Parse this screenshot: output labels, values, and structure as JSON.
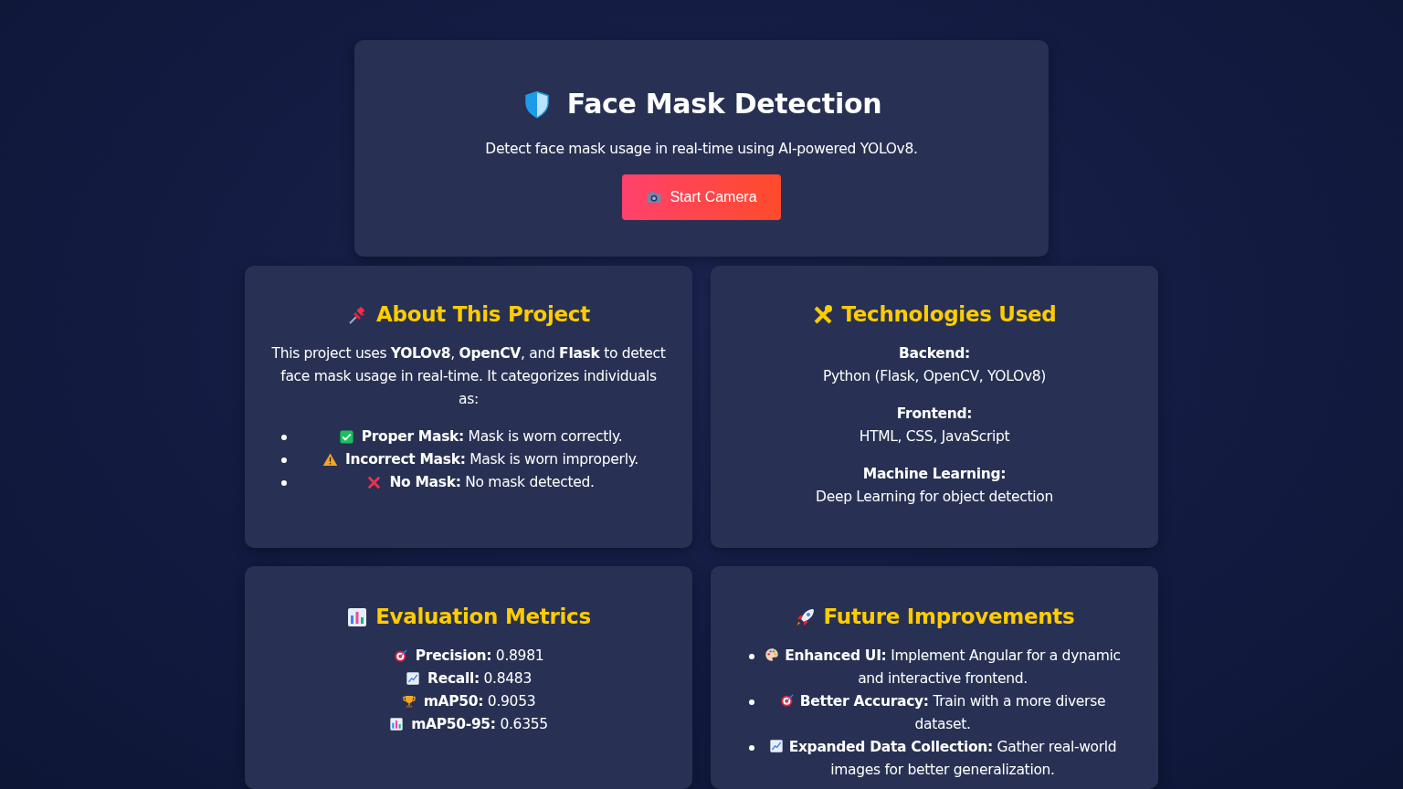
{
  "header": {
    "kind": "shield",
    "title": "Face Mask Detection",
    "subtitle": "Detect face mask usage in real-time using AI-powered YOLOv8.",
    "button": {
      "kind": "camera",
      "label": "Start Camera"
    }
  },
  "about": {
    "kind": "pin",
    "title": "About This Project",
    "intro": "This project uses **YOLOv8**, **OpenCV**, and **Flask** to detect face mask usage in real-time. It categorizes individuals as:",
    "items": [
      {
        "kind": "check",
        "label": "Proper Mask:",
        "text": "Mask is worn correctly."
      },
      {
        "kind": "warning",
        "label": "Incorrect Mask:",
        "text": "Mask is worn improperly."
      },
      {
        "kind": "cross",
        "label": "No Mask:",
        "text": "No mask detected."
      }
    ]
  },
  "technologies": {
    "kind": "tools",
    "title": "Technologies Used",
    "groups": [
      {
        "label": "Backend:",
        "value": "Python (Flask, OpenCV, YOLOv8)"
      },
      {
        "label": "Frontend:",
        "value": "HTML, CSS, JavaScript"
      },
      {
        "label": "Machine Learning:",
        "value": "Deep Learning for object detection"
      }
    ]
  },
  "metrics": {
    "kind": "barchart",
    "title": "Evaluation Metrics",
    "items": [
      {
        "kind": "target",
        "label": "Precision:",
        "value": "0.8981"
      },
      {
        "kind": "trend",
        "label": "Recall:",
        "value": "0.8483"
      },
      {
        "kind": "trophy",
        "label": "mAP50:",
        "value": "0.9053"
      },
      {
        "kind": "barchart",
        "label": "mAP50-95:",
        "value": "0.6355"
      }
    ]
  },
  "future": {
    "kind": "rocket",
    "title": "Future Improvements",
    "items": [
      {
        "kind": "palette",
        "label": "Enhanced UI:",
        "text": "Implement Angular for a dynamic and interactive frontend."
      },
      {
        "kind": "target",
        "label": "Better Accuracy:",
        "text": "Train with a more diverse dataset."
      },
      {
        "kind": "trend",
        "label": "Expanded Data Collection:",
        "text": "Gather real-world images for better generalization."
      }
    ]
  }
}
